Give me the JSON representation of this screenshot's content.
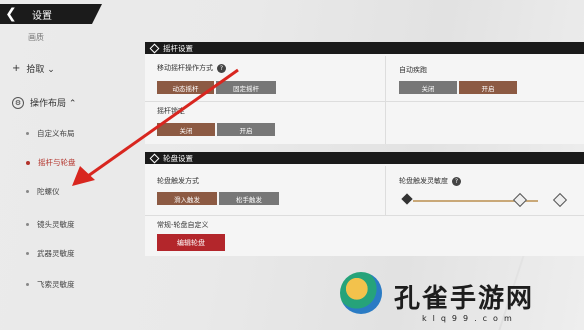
{
  "header": {
    "back_icon": "back-chevron-icon",
    "title": "设置"
  },
  "sidebar": {
    "cut_label": "画质",
    "groups": [
      {
        "label": "拾取 ⌄",
        "icon": "plus-icon"
      },
      {
        "label": "操作布局 ⌃",
        "icon": "gear-icon"
      }
    ],
    "items": [
      {
        "label": "自定义布局",
        "active": false
      },
      {
        "label": "摇杆与轮盘",
        "active": true
      },
      {
        "label": "陀螺仪",
        "active": false
      },
      {
        "label": "镜头灵敏度",
        "active": false
      },
      {
        "label": "武器灵敏度",
        "active": false
      },
      {
        "label": "飞索灵敏度",
        "active": false
      }
    ]
  },
  "joystick": {
    "section_title": "摇杆设置",
    "move_mode": {
      "label": "移动摇杆操作方式",
      "options": [
        "动态摇杆",
        "固定摇杆"
      ],
      "selected": 0
    },
    "auto_sprint": {
      "label": "自动疾跑",
      "options": [
        "关闭",
        "开启"
      ],
      "selected": 1
    },
    "lock": {
      "label": "摇杆锁定",
      "options": [
        "关闭",
        "开启"
      ],
      "selected": 0
    }
  },
  "wheel": {
    "section_title": "轮盘设置",
    "trigger": {
      "label": "轮盘触发方式",
      "options": [
        "滑入触发",
        "松手触发"
      ],
      "selected": 0
    },
    "sensitivity": {
      "label": "轮盘触发灵敏度",
      "level": 0.75
    },
    "custom": {
      "label": "常规-轮盘自定义",
      "button": "编辑轮盘"
    }
  },
  "colors": {
    "accent": "#b3262b",
    "selected": "#8c5a43",
    "dark": "#1a1a1a"
  },
  "watermark": {
    "brand": "孔雀手游网",
    "url": "klq99.com"
  }
}
